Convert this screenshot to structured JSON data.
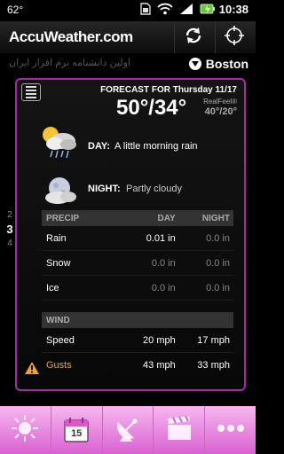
{
  "status_bar": {
    "temperature": "62°",
    "time": "10:38",
    "icons": [
      "sim-icon",
      "wifi-icon",
      "signal-icon",
      "battery-icon"
    ]
  },
  "header": {
    "logo": "AccuWeather.com",
    "refresh_icon": "refresh-icon",
    "locate_icon": "crosshair-icon"
  },
  "watermark": "اولین دانشنامه نرم افزار ایران",
  "location": {
    "city": "Boston"
  },
  "forecast": {
    "title": "FORECAST FOR Thursday 11/17",
    "temps": "50°/34°",
    "realfeel_label": "RealFeel®",
    "realfeel_value": "40°/20°",
    "day_label": "DAY:",
    "day_text": "A little morning rain",
    "night_label": "NIGHT:",
    "night_text": "Partly cloudy"
  },
  "precip_table": {
    "headers": [
      "PRECIP",
      "DAY",
      "NIGHT"
    ],
    "rows": [
      {
        "label": "Rain",
        "day": "0.01 in",
        "night": "0.0 in"
      },
      {
        "label": "Snow",
        "day": "0.0 in",
        "night": "0.0 in"
      },
      {
        "label": "Ice",
        "day": "0.0 in",
        "night": "0.0 in"
      }
    ]
  },
  "wind_table": {
    "header": "WIND",
    "rows": [
      {
        "label": "Speed",
        "day": "20 mph",
        "night": "17 mph"
      },
      {
        "label": "Gusts",
        "day": "43 mph",
        "night": "33 mph"
      }
    ]
  },
  "pager": {
    "prev": "2",
    "current": "3",
    "next": "4"
  },
  "bottom_nav": [
    "sun-icon",
    "calendar-icon",
    "radar-dish-icon",
    "video-clapper-icon",
    "more-dots-icon"
  ],
  "calendar_day": "15",
  "colors": {
    "accent": "#a62aa6",
    "nav": "#e58ae0",
    "warning": "#f0a030"
  }
}
